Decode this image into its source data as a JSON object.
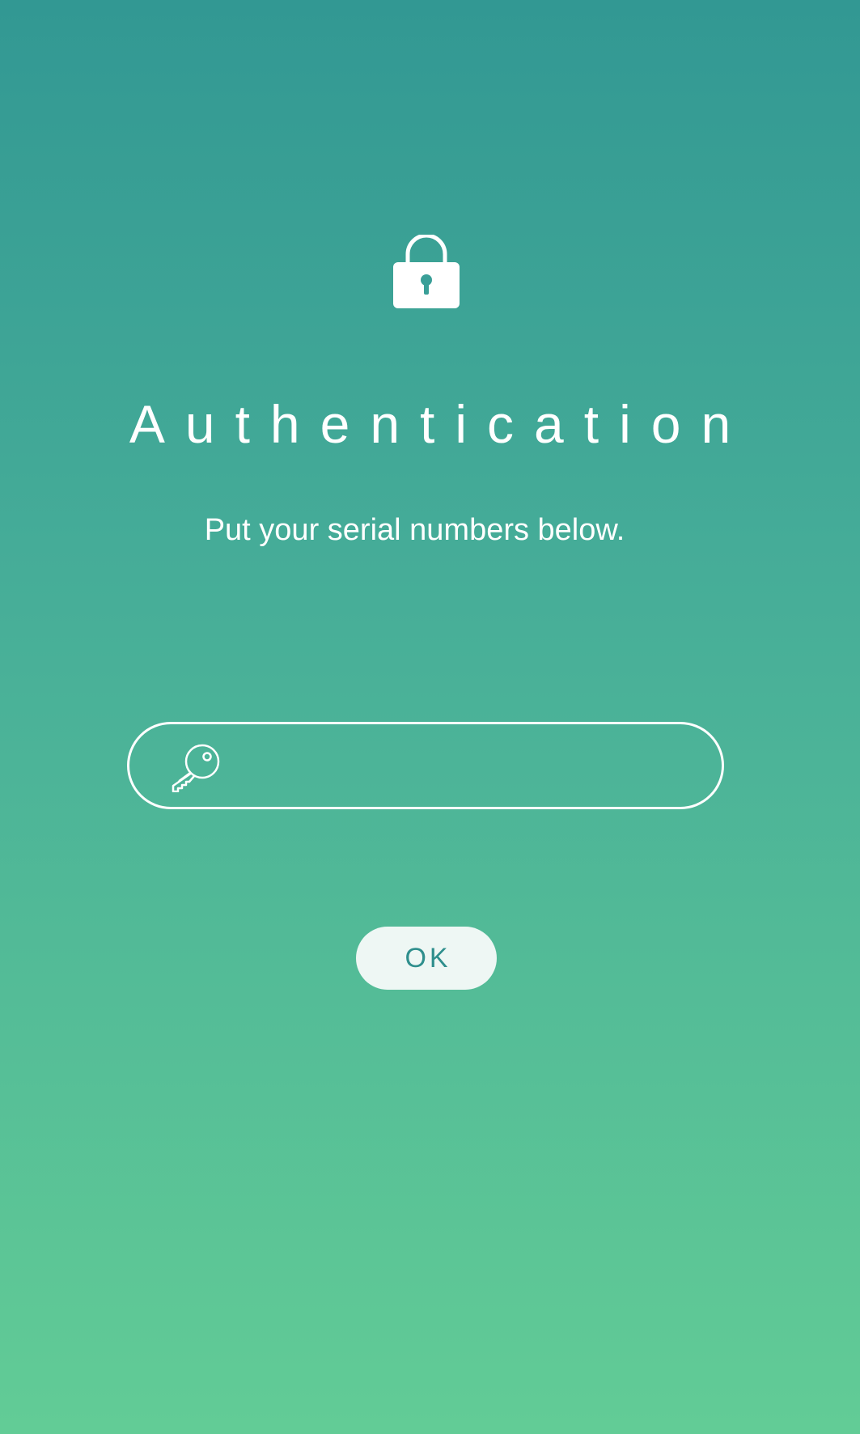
{
  "auth": {
    "title": "Authentication",
    "subtitle": "Put your serial numbers below.",
    "serial_input": {
      "value": "",
      "placeholder": ""
    },
    "ok_label": "OK"
  },
  "icons": {
    "lock": "lock-icon",
    "key": "key-icon"
  },
  "colors": {
    "background_top": "#329893",
    "background_bottom": "#62cc96",
    "button_fill": "#eef7f4",
    "button_text": "#2f8f8d",
    "foreground": "#ffffff"
  }
}
